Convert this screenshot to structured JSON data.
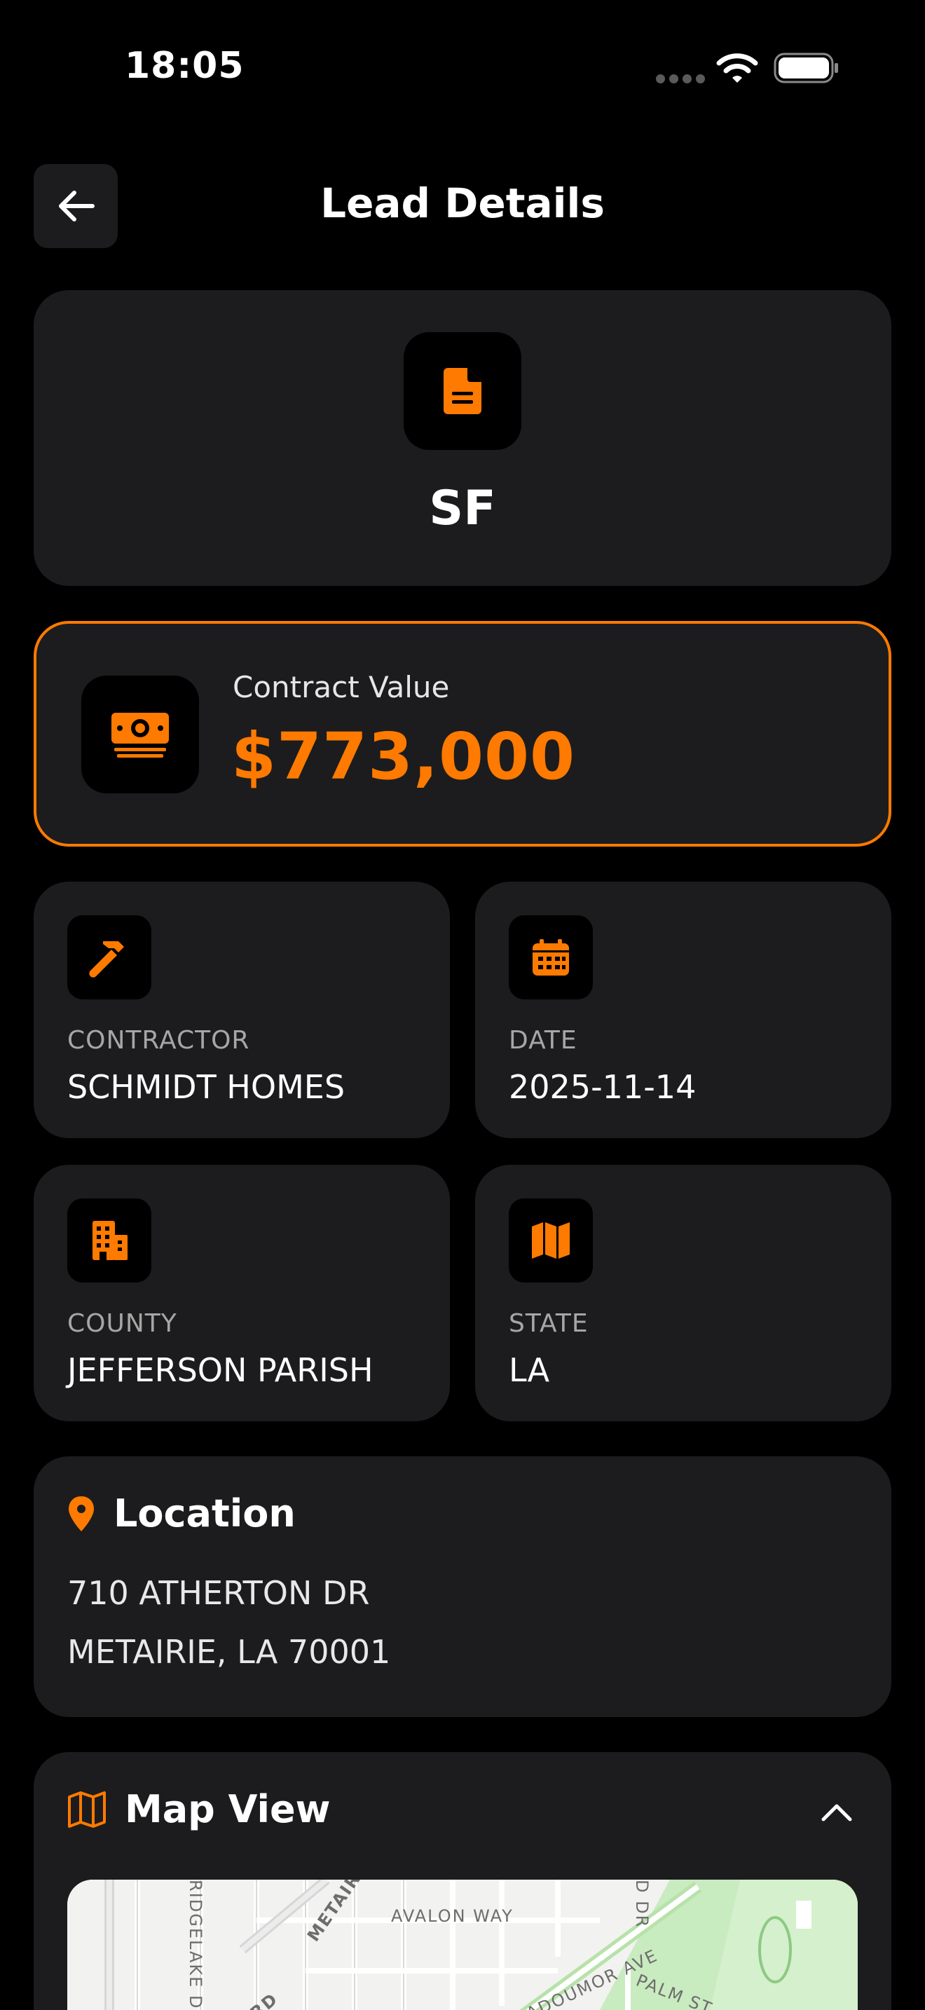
{
  "status_bar": {
    "time": "18:05"
  },
  "header": {
    "title": "Lead Details"
  },
  "lead": {
    "name": "SF"
  },
  "contract": {
    "label": "Contract Value",
    "value": "$773,000"
  },
  "tiles": [
    {
      "label": "CONTRACTOR",
      "value": "SCHMIDT HOMES",
      "icon": "hammer-icon"
    },
    {
      "label": "DATE",
      "value": "2025-11-14",
      "icon": "calendar-icon"
    },
    {
      "label": "COUNTY",
      "value": "JEFFERSON PARISH",
      "icon": "building-icon"
    },
    {
      "label": "STATE",
      "value": "LA",
      "icon": "map-icon"
    }
  ],
  "location": {
    "title": "Location",
    "address_line1": "710 ATHERTON DR",
    "address_line2": "METAIRIE, LA 70001"
  },
  "map": {
    "title": "Map View",
    "streets": [
      "AVALON WAY",
      "PALM ST",
      "ADOUMOR AVE",
      "METAIRIE",
      "RIDGELAKE DR",
      "RD",
      "D DR"
    ]
  },
  "colors": {
    "accent": "#ff7a00",
    "card": "#1c1c1e",
    "background": "#000000"
  }
}
